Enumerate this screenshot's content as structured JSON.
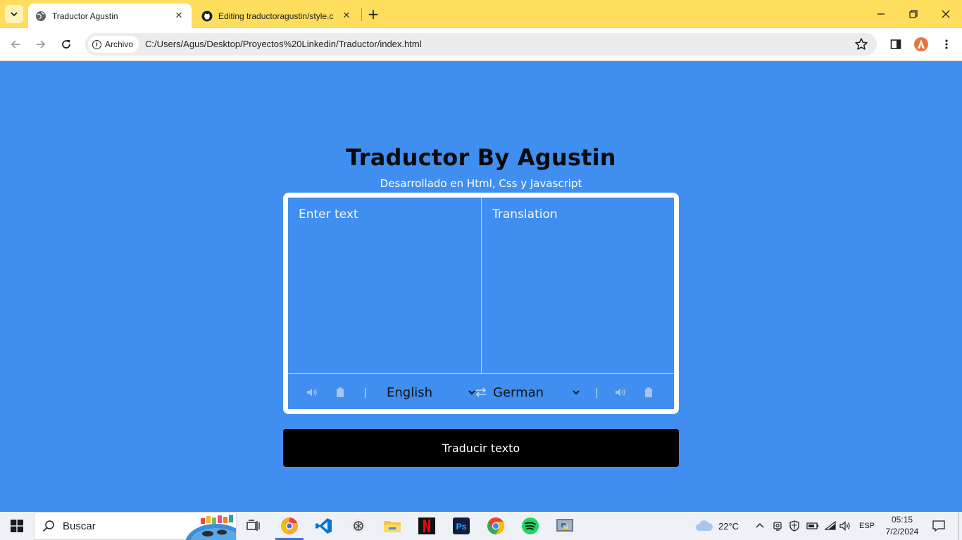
{
  "browser": {
    "tabs": [
      {
        "title": "Traductor Agustin",
        "active": true
      },
      {
        "title": "Editing traductoragustin/style.c",
        "active": false
      }
    ],
    "security_label": "Archivo",
    "url": "C:/Users/Agus/Desktop/Proyectos%20Linkedin/Traductor/index.html"
  },
  "app": {
    "title": "Traductor By Agustin",
    "subtitle": "Desarrollado en Html, Css y Javascript",
    "input_placeholder": "Enter text",
    "output_placeholder": "Translation",
    "source_language": "English",
    "target_language": "German",
    "translate_button": "Traducir texto"
  },
  "taskbar": {
    "search_label": "Buscar",
    "weather": "22°C",
    "language": "ESP",
    "time": "05:15",
    "date": "7/2/2024",
    "apps": [
      "chrome-canary-icon",
      "vscode-icon",
      "chatgpt-icon",
      "file-explorer-icon",
      "netflix-icon",
      "photoshop-icon",
      "chrome-icon",
      "spotify-icon",
      "python-icon"
    ]
  },
  "colors": {
    "page_background": "#3f8ef0",
    "tabbar_background": "#fede5c",
    "button_background": "#000000",
    "card_border": "#ffffff"
  }
}
